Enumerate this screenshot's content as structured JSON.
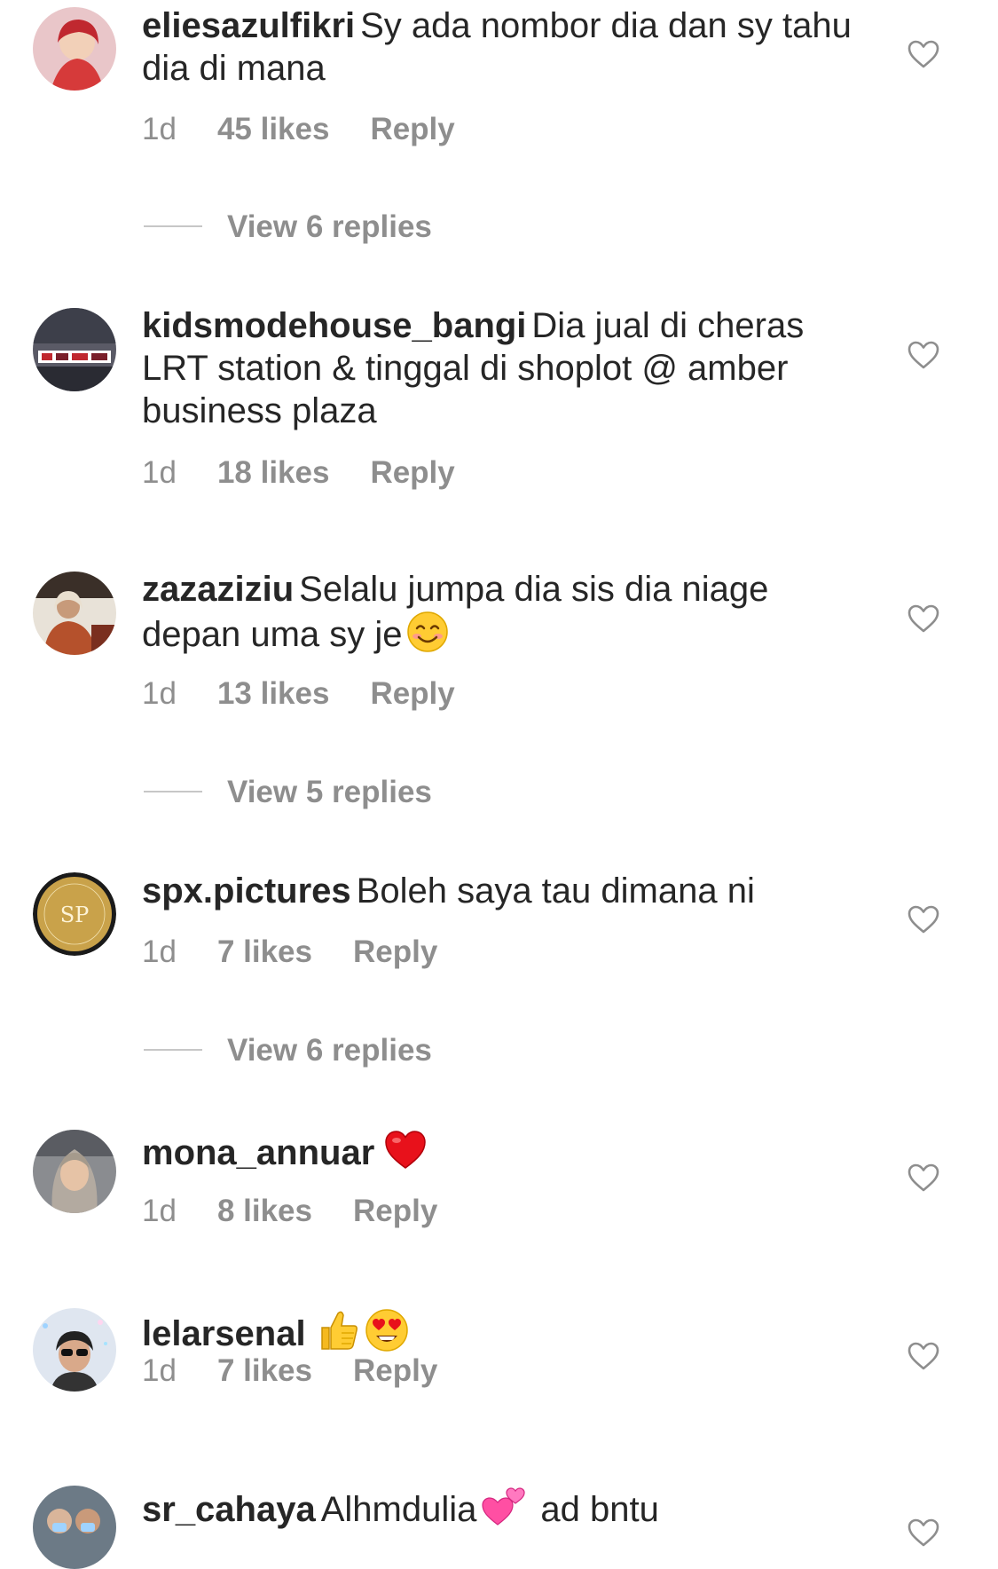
{
  "comments": [
    {
      "username": "eliesazulfikri",
      "text": "Sy ada nombor dia dan sy tahu dia di mana",
      "time": "1d",
      "likes": "45 likes",
      "reply": "Reply",
      "view_replies": "View 6 replies"
    },
    {
      "username": "kidsmodehouse_bangi",
      "text": "Dia jual di cheras LRT station & tinggal di shoplot @ amber business plaza",
      "time": "1d",
      "likes": "18 likes",
      "reply": "Reply"
    },
    {
      "username": "zazaziziu",
      "text": "Selalu jumpa dia sis dia niage depan uma sy je",
      "time": "1d",
      "likes": "13 likes",
      "reply": "Reply",
      "view_replies": "View 5 replies"
    },
    {
      "username": "spx.pictures",
      "text": "Boleh saya tau dimana ni",
      "time": "1d",
      "likes": "7 likes",
      "reply": "Reply",
      "view_replies": "View 6 replies",
      "avatar_text": "SP"
    },
    {
      "username": "mona_annuar",
      "text": "",
      "time": "1d",
      "likes": "8 likes",
      "reply": "Reply"
    },
    {
      "username": "lelarsenal",
      "text": "",
      "time": "1d",
      "likes": "7 likes",
      "reply": "Reply"
    },
    {
      "username": "sr_cahaya",
      "text": "Alhmdulia",
      "text2": "ad bntu"
    }
  ],
  "emoji_icons": [
    "smiling-face-emoji",
    "red-heart-emoji",
    "thumbs-up-emoji",
    "heart-eyes-emoji",
    "two-hearts-emoji"
  ],
  "colors": {
    "text": "#262626",
    "meta": "#8e8e8e",
    "divider": "#c7c7c7"
  }
}
